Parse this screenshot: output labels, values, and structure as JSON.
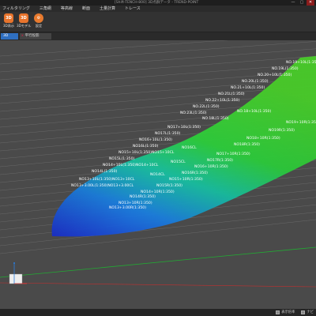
{
  "window": {
    "title": "[Shift-TENCH-800] 3D点群データ - TREND-POINT",
    "controls": [
      "—",
      "▢",
      "✕"
    ]
  },
  "menu": [
    "フィルタリング",
    "三角網",
    "等高線",
    "断面",
    "土量計算",
    "トレース"
  ],
  "ribbon": [
    {
      "icon": "3D",
      "label": "3D表示",
      "icon_name": "3d-view-icon"
    },
    {
      "icon": "3D",
      "label": "3Dモデル",
      "icon_name": "3d-model-icon"
    },
    {
      "icon": "⚙",
      "label": "設定",
      "icon_name": "settings-icon"
    }
  ],
  "tabs": {
    "view_tab": "3D",
    "doc_tab": "平行投影",
    "doc_close": "x"
  },
  "labels": [
    "NO.19+10L(1:350)",
    "NO.19L(1:350)",
    "NO.20+10L(1:350)",
    "NO.20L(1:350)",
    "NO.21+10L(1:350)",
    "NO.21L(1:350)",
    "NO.22+10L(1:350)",
    "NO.22L(1:350)",
    "NO.23L(1:350)",
    "NO.18+10L(1:350)",
    "NO.18L(1:350)",
    "NO17+10L(1:350)",
    "NO17L(1:350)",
    "NO16+10L(1:350)",
    "NO16L(1:350)",
    "NO15+10L(1:350)NO15+10CL",
    "NO15L(1:350)",
    "NO14+10L(1:350)NO14+10CL",
    "NO14L(1:350)",
    "NO13+10L(1:350)NO13+10CL",
    "NO13+3.00L(1:350)NO13+3.00CL",
    "NO19+10R(1:350)",
    "NO19R(1:350)",
    "NO18+10R(1:350)",
    "NO18R(1:350)",
    "NO17+10R(1:350)",
    "NO17R(1:350)",
    "NO16+10R(1:350)",
    "NO16R(1:350)",
    "NO15+10R(1:350)",
    "NO15R(1:350)",
    "NO14+10R(1:350)",
    "NO14R(1:350)",
    "NO13+10R(1:350)",
    "NO13+3.00R(1:350)",
    "NO16CL",
    "NO15CL",
    "NO14CL"
  ],
  "status": {
    "item1": "表示倍率",
    "item2": "ナビ"
  },
  "colors": {
    "ribbon_accent": "#e8742c",
    "tab_active": "#2f6fc0",
    "ground_line": "#22aa33"
  }
}
